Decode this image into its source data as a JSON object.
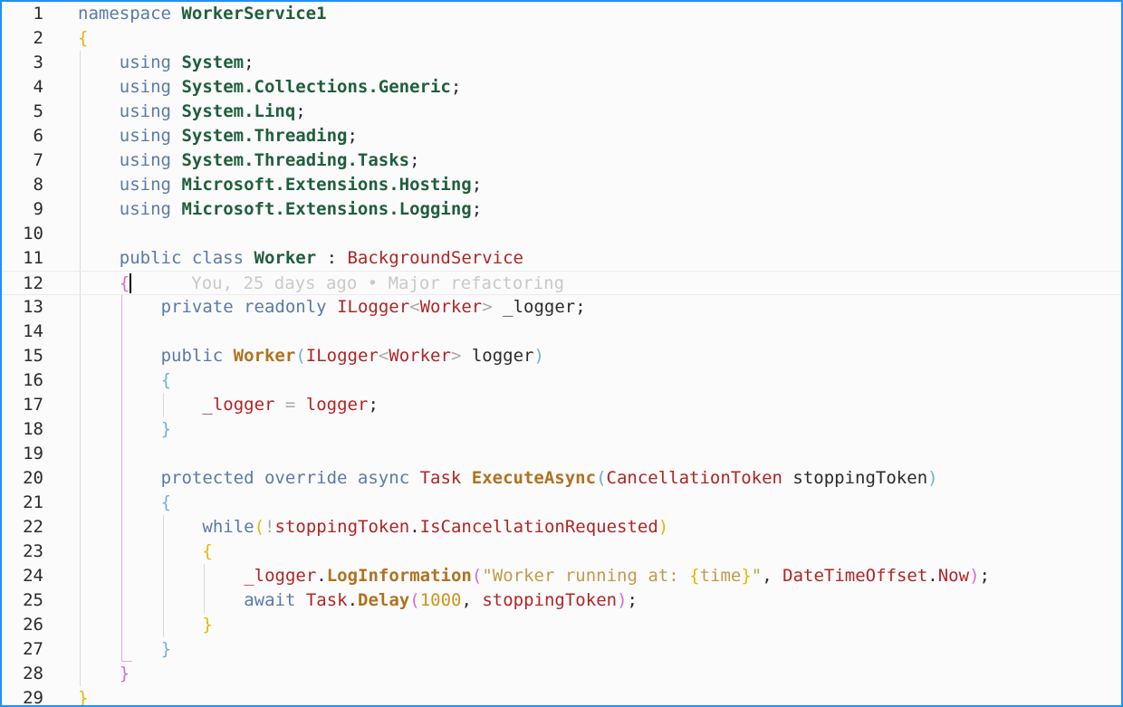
{
  "editor": {
    "cursor_line": 12,
    "blame": {
      "line": 12,
      "text": "You, 25 days ago • Major refactoring"
    },
    "lines": [
      {
        "n": 1,
        "indent": 0,
        "tokens": [
          [
            "kw",
            "namespace "
          ],
          [
            "ns",
            "WorkerService1"
          ]
        ]
      },
      {
        "n": 2,
        "indent": 0,
        "tokens": [
          [
            "br1",
            "{"
          ]
        ]
      },
      {
        "n": 3,
        "indent": 1,
        "tokens": [
          [
            "kw",
            "using "
          ],
          [
            "ns",
            "System"
          ],
          [
            "pun",
            ";"
          ]
        ]
      },
      {
        "n": 4,
        "indent": 1,
        "tokens": [
          [
            "kw",
            "using "
          ],
          [
            "ns",
            "System.Collections.Generic"
          ],
          [
            "pun",
            ";"
          ]
        ]
      },
      {
        "n": 5,
        "indent": 1,
        "tokens": [
          [
            "kw",
            "using "
          ],
          [
            "ns",
            "System.Linq"
          ],
          [
            "pun",
            ";"
          ]
        ]
      },
      {
        "n": 6,
        "indent": 1,
        "tokens": [
          [
            "kw",
            "using "
          ],
          [
            "ns",
            "System.Threading"
          ],
          [
            "pun",
            ";"
          ]
        ]
      },
      {
        "n": 7,
        "indent": 1,
        "tokens": [
          [
            "kw",
            "using "
          ],
          [
            "ns",
            "System.Threading.Tasks"
          ],
          [
            "pun",
            ";"
          ]
        ]
      },
      {
        "n": 8,
        "indent": 1,
        "tokens": [
          [
            "kw",
            "using "
          ],
          [
            "ns",
            "Microsoft.Extensions.Hosting"
          ],
          [
            "pun",
            ";"
          ]
        ]
      },
      {
        "n": 9,
        "indent": 1,
        "tokens": [
          [
            "kw",
            "using "
          ],
          [
            "ns",
            "Microsoft.Extensions.Logging"
          ],
          [
            "pun",
            ";"
          ]
        ]
      },
      {
        "n": 10,
        "indent": 0,
        "tokens": []
      },
      {
        "n": 11,
        "indent": 1,
        "tokens": [
          [
            "kw",
            "public class "
          ],
          [
            "cls",
            "Worker"
          ],
          [
            "pun",
            " : "
          ],
          [
            "ty",
            "BackgroundService"
          ]
        ]
      },
      {
        "n": 12,
        "indent": 1,
        "tokens": [
          [
            "br2",
            "{"
          ]
        ]
      },
      {
        "n": 13,
        "indent": 2,
        "tokens": [
          [
            "kw",
            "private readonly "
          ],
          [
            "ty",
            "ILogger"
          ],
          [
            "op",
            "<"
          ],
          [
            "ty",
            "Worker"
          ],
          [
            "op",
            "> "
          ],
          [
            "id",
            "_logger"
          ],
          [
            "pun",
            ";"
          ]
        ]
      },
      {
        "n": 14,
        "indent": 0,
        "tokens": []
      },
      {
        "n": 15,
        "indent": 2,
        "tokens": [
          [
            "kw",
            "public "
          ],
          [
            "fn",
            "Worker"
          ],
          [
            "br3",
            "("
          ],
          [
            "ty",
            "ILogger"
          ],
          [
            "op",
            "<"
          ],
          [
            "ty",
            "Worker"
          ],
          [
            "op",
            "> "
          ],
          [
            "id",
            "logger"
          ],
          [
            "br3",
            ")"
          ]
        ]
      },
      {
        "n": 16,
        "indent": 2,
        "tokens": [
          [
            "br3",
            "{"
          ]
        ]
      },
      {
        "n": 17,
        "indent": 3,
        "tokens": [
          [
            "var",
            "_logger"
          ],
          [
            "op",
            " = "
          ],
          [
            "var",
            "logger"
          ],
          [
            "pun",
            ";"
          ]
        ]
      },
      {
        "n": 18,
        "indent": 2,
        "tokens": [
          [
            "br3",
            "}"
          ]
        ]
      },
      {
        "n": 19,
        "indent": 0,
        "tokens": []
      },
      {
        "n": 20,
        "indent": 2,
        "tokens": [
          [
            "kw",
            "protected override async "
          ],
          [
            "ty",
            "Task "
          ],
          [
            "fn",
            "ExecuteAsync"
          ],
          [
            "br3",
            "("
          ],
          [
            "ty",
            "CancellationToken "
          ],
          [
            "id",
            "stoppingToken"
          ],
          [
            "br3",
            ")"
          ]
        ]
      },
      {
        "n": 21,
        "indent": 2,
        "tokens": [
          [
            "br3",
            "{"
          ]
        ]
      },
      {
        "n": 22,
        "indent": 3,
        "tokens": [
          [
            "kw",
            "while"
          ],
          [
            "br1",
            "("
          ],
          [
            "op",
            "!"
          ],
          [
            "var",
            "stoppingToken"
          ],
          [
            "pun",
            "."
          ],
          [
            "var",
            "IsCancellationRequested"
          ],
          [
            "br1",
            ")"
          ]
        ]
      },
      {
        "n": 23,
        "indent": 3,
        "tokens": [
          [
            "br1",
            "{"
          ]
        ]
      },
      {
        "n": 24,
        "indent": 4,
        "tokens": [
          [
            "var",
            "_logger"
          ],
          [
            "pun",
            "."
          ],
          [
            "fn",
            "LogInformation"
          ],
          [
            "br2",
            "("
          ],
          [
            "str",
            "\"Worker running at: "
          ],
          [
            "br1",
            "{"
          ],
          [
            "str",
            "time"
          ],
          [
            "br1",
            "}"
          ],
          [
            "str",
            "\""
          ],
          [
            "pun",
            ", "
          ],
          [
            "ty",
            "DateTimeOffset"
          ],
          [
            "pun",
            "."
          ],
          [
            "ty",
            "Now"
          ],
          [
            "br2",
            ")"
          ],
          [
            "pun",
            ";"
          ]
        ]
      },
      {
        "n": 25,
        "indent": 4,
        "tokens": [
          [
            "kw",
            "await "
          ],
          [
            "ty",
            "Task"
          ],
          [
            "pun",
            "."
          ],
          [
            "fn",
            "Delay"
          ],
          [
            "br2",
            "("
          ],
          [
            "num",
            "1000"
          ],
          [
            "pun",
            ", "
          ],
          [
            "var",
            "stoppingToken"
          ],
          [
            "br2",
            ")"
          ],
          [
            "pun",
            ";"
          ]
        ]
      },
      {
        "n": 26,
        "indent": 3,
        "tokens": [
          [
            "br1",
            "}"
          ]
        ]
      },
      {
        "n": 27,
        "indent": 2,
        "tokens": [
          [
            "br3",
            "}"
          ]
        ]
      },
      {
        "n": 28,
        "indent": 1,
        "tokens": [
          [
            "br2",
            "}"
          ]
        ]
      },
      {
        "n": 29,
        "indent": 0,
        "tokens": [
          [
            "br1",
            "}"
          ]
        ]
      }
    ]
  }
}
